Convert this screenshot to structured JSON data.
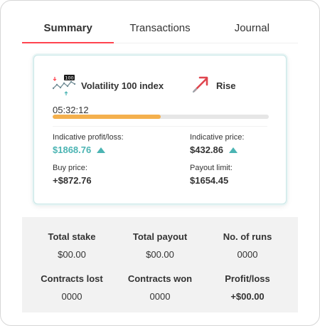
{
  "tabs": [
    {
      "label": "Summary",
      "active": true
    },
    {
      "label": "Transactions",
      "active": false
    },
    {
      "label": "Journal",
      "active": false
    }
  ],
  "contract": {
    "market_icon": "volatility-100-icon",
    "market_badge": "100",
    "market_name": "Volatility 100 index",
    "trade_icon": "rise-arrow-icon",
    "trade_type": "Rise",
    "timer": "05:32:12",
    "progress": 0.5,
    "indicative_profit_label": "Indicative profit/loss:",
    "indicative_profit_value": "$1868.76",
    "indicative_price_label": "Indicative price:",
    "indicative_price_value": "$432.86",
    "buy_price_label": "Buy price:",
    "buy_price_value": "+$872.76",
    "payout_limit_label": "Payout limit:",
    "payout_limit_value": "$1654.45"
  },
  "summary": {
    "total_stake_label": "Total stake",
    "total_stake_value": "$00.00",
    "total_payout_label": "Total payout",
    "total_payout_value": "$00.00",
    "runs_label": "No. of runs",
    "runs_value": "0000",
    "lost_label": "Contracts lost",
    "lost_value": "0000",
    "won_label": "Contracts won",
    "won_value": "0000",
    "profit_label": "Profit/loss",
    "profit_value": "+$00.00"
  },
  "colors": {
    "accent": "#ff444f",
    "profit": "#4bb4b3",
    "progress": "#f4b04d",
    "stats_bg": "#f2f2f2"
  }
}
